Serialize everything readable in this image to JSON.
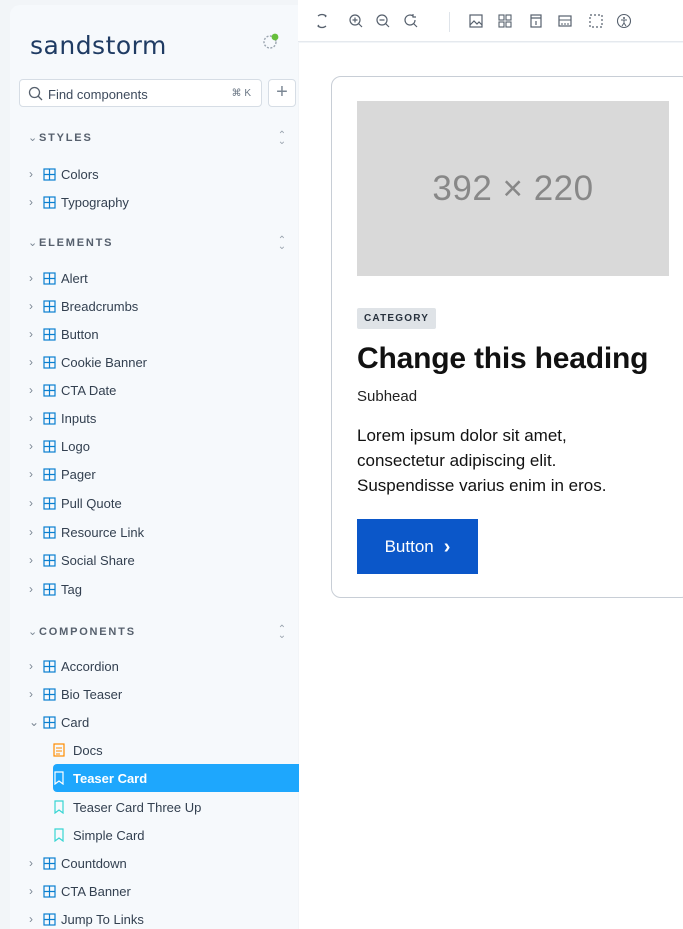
{
  "app": {
    "logo": "sandstorm"
  },
  "search": {
    "placeholder": "Find components",
    "shortcut": "⌘ K"
  },
  "sidebar": {
    "styles": {
      "title": "STYLES",
      "items": [
        "Colors",
        "Typography"
      ]
    },
    "elements": {
      "title": "ELEMENTS",
      "items": [
        "Alert",
        "Breadcrumbs",
        "Button",
        "Cookie Banner",
        "CTA Date",
        "Inputs",
        "Logo",
        "Pager",
        "Pull Quote",
        "Resource Link",
        "Social Share",
        "Tag"
      ]
    },
    "components": {
      "title": "COMPONENTS",
      "items": [
        "Accordion",
        "Bio Teaser",
        "Card"
      ],
      "card_children": [
        "Docs",
        "Teaser Card",
        "Teaser Card Three Up",
        "Simple Card"
      ],
      "after": [
        "Countdown",
        "CTA Banner",
        "Jump To Links"
      ]
    }
  },
  "preview": {
    "image": "392 × 220",
    "category": "CATEGORY",
    "heading": "Change this heading",
    "subhead": "Subhead",
    "body": "Lorem ipsum dolor sit amet, consectetur adipiscing elit. Suspendisse varius enim in eros.",
    "button": "Button"
  },
  "colors": {
    "accent": "#1ea7fd",
    "button": "#0b57c9",
    "placeholder": "#d9d9d9"
  },
  "toolbar": {
    "icons": [
      "reload-icon",
      "zoom-in-icon",
      "zoom-out-icon",
      "reset-zoom-icon",
      "background-icon",
      "grid-icon",
      "viewport-icon",
      "measure-icon",
      "outline-icon",
      "accessibility-icon"
    ]
  }
}
